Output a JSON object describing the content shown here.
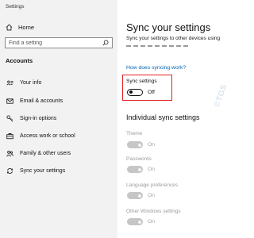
{
  "window": {
    "title": "Settings"
  },
  "sidebar": {
    "home_label": "Home",
    "search_placeholder": "Find a setting",
    "section_title": "Accounts",
    "items": [
      {
        "label": "Your info",
        "icon": "person-card-icon"
      },
      {
        "label": "Email & accounts",
        "icon": "mail-icon"
      },
      {
        "label": "Sign-in options",
        "icon": "key-icon"
      },
      {
        "label": "Access work or school",
        "icon": "briefcase-icon"
      },
      {
        "label": "Family & other users",
        "icon": "people-icon"
      },
      {
        "label": "Sync your settings",
        "icon": "sync-icon",
        "active": true
      }
    ]
  },
  "main": {
    "title": "Sync your settings",
    "description": "Sync your settings to other devices using",
    "link": "How does syncing work?",
    "sync_toggle": {
      "label": "Sync settings",
      "state_text": "Off",
      "on": false
    },
    "individual_heading": "Individual sync settings",
    "individual": [
      {
        "label": "Theme",
        "state_text": "On",
        "on": true,
        "disabled": true
      },
      {
        "label": "Passwords",
        "state_text": "On",
        "on": true,
        "disabled": true
      },
      {
        "label": "Language preferences",
        "state_text": "On",
        "on": true,
        "disabled": true
      },
      {
        "label": "Other Windows settings",
        "state_text": "On",
        "on": true,
        "disabled": true
      }
    ]
  },
  "watermark": "©TGS",
  "colors": {
    "link": "#0063b1",
    "highlight": "#e02424",
    "sidebar_bg": "#f2f2f2"
  }
}
